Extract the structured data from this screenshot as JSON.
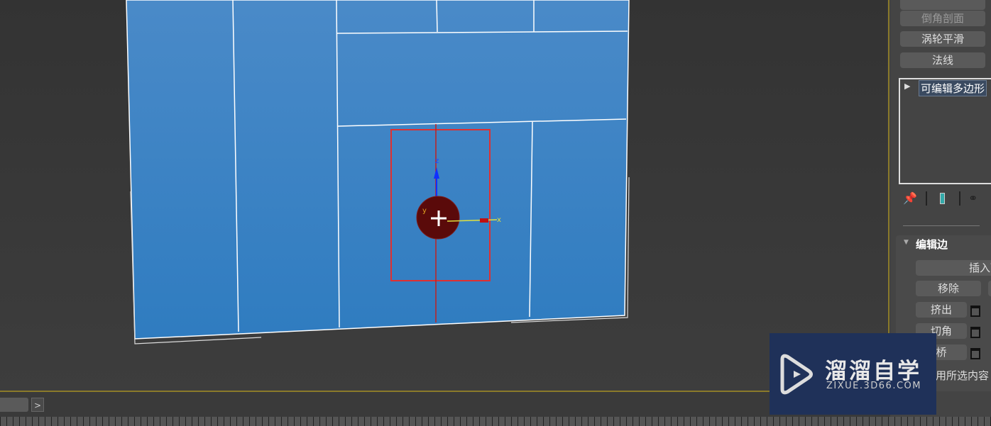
{
  "panel": {
    "buttons": [
      "倒角剖面",
      "涡轮平滑",
      "法线"
    ],
    "stack_item": "可编辑多边形",
    "rollout_title": "编辑边",
    "edit_buttons": [
      "插入顶",
      "移除",
      "挤出",
      "切角",
      "桥"
    ],
    "use_selection": "用所选内容"
  },
  "gizmo": {
    "x_label": "x",
    "y_label": "y",
    "z_label": "z"
  },
  "watermark": {
    "title": "溜溜自学",
    "url": "ZIXUE.3D66.COM"
  },
  "colors": {
    "plane": "#3d85c6",
    "selection": "#e03030",
    "panel": "#444444"
  }
}
